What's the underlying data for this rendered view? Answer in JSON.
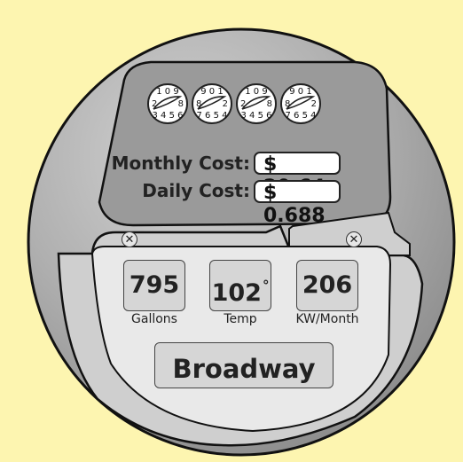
{
  "meter": {
    "dials": [
      {
        "top": "1 0 9",
        "left": "2",
        "right": "8",
        "bottom": "3 4 5 6"
      },
      {
        "top": "9 0 1",
        "left": "8",
        "right": "2",
        "bottom": "7 6 5 4"
      },
      {
        "top": "1 0 9",
        "left": "2",
        "right": "8",
        "bottom": "3 4 5 6"
      },
      {
        "top": "9 0 1",
        "left": "8",
        "right": "2",
        "bottom": "7 6 5 4"
      }
    ],
    "monthly_cost_label": "Monthly Cost:",
    "monthly_cost_value": "$ 20.64",
    "daily_cost_label": "Daily Cost:",
    "daily_cost_value": "$ 0.688"
  },
  "stats": {
    "gallons": {
      "value": "795",
      "label": "Gallons"
    },
    "temp": {
      "value": "102",
      "unit": "°",
      "label": "Temp"
    },
    "kw": {
      "value": "206",
      "label": "KW/Month"
    }
  },
  "location_button": "Broadway",
  "close_icons": [
    "close-icon-left",
    "close-icon-right"
  ],
  "colors": {
    "background": "#fdf5b0",
    "meter_outer": "#a8a8a8",
    "display_panel": "#9a9a9a",
    "lower_panel": "#d0d0d0",
    "button_fill": "#d6d6d6"
  }
}
